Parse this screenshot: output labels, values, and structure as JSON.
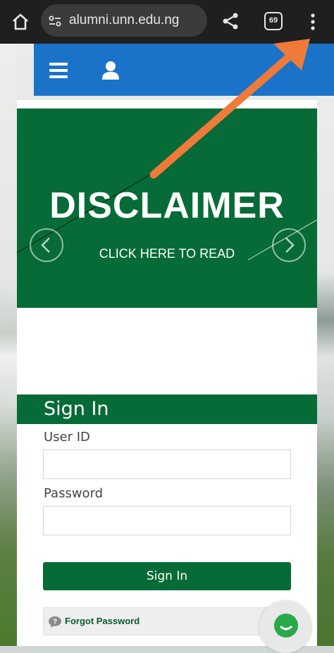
{
  "browser": {
    "url": "alumni.unn.edu.ng",
    "tab_count": "69"
  },
  "banner": {
    "title": "DISCLAIMER",
    "subtitle": "CLICK HERE TO READ"
  },
  "signin": {
    "title": "Sign In",
    "user_id_label": "User ID",
    "user_id_value": "",
    "password_label": "Password",
    "password_value": "",
    "button_label": "Sign In",
    "forgot_label": "Forgot Password"
  },
  "colors": {
    "nav_blue": "#1a73c9",
    "brand_green": "#076b37",
    "chat_green": "#2aa84a",
    "annotation_orange": "#f07a3a"
  },
  "icons": [
    "home-icon",
    "site-info-icon",
    "share-icon",
    "tabs-icon",
    "more-vert-icon",
    "menu-icon",
    "user-icon",
    "chevron-left-icon",
    "chevron-right-icon",
    "question-icon",
    "chat-icon"
  ]
}
